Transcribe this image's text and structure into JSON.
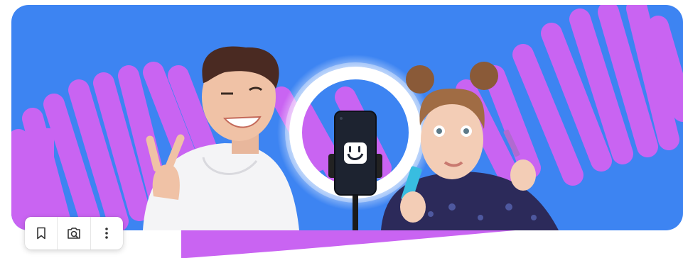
{
  "banner": {
    "image": "promo-banner-streamers",
    "background_color": "#3d84f2",
    "stroke_color": "#c964f2",
    "ring_light_color": "#ffffff",
    "phone_logo_icon": "smiley-app-logo-icon"
  },
  "toolbar": {
    "buttons": [
      {
        "icon": "bookmark-icon"
      },
      {
        "icon": "visual-search-icon"
      },
      {
        "icon": "more-vertical-icon"
      }
    ]
  }
}
